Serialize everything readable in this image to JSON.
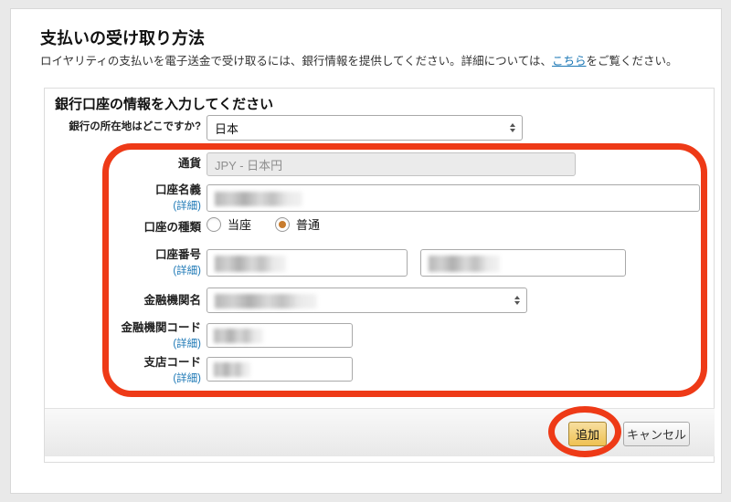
{
  "page": {
    "title": "支払いの受け取り方法",
    "subtitle_before": "ロイヤリティの支払いを電子送金で受け取るには、銀行情報を提供してください。詳細については、",
    "subtitle_link": "こちら",
    "subtitle_after": "をご覧ください。"
  },
  "panel": {
    "title": "銀行口座の情報を入力してください",
    "fields": {
      "bank_location": {
        "label": "銀行の所在地はどこですか?",
        "value": "日本"
      },
      "currency": {
        "label": "通貨",
        "value": "JPY - 日本円",
        "disabled": true
      },
      "account_name": {
        "label": "口座名義",
        "detail_link": "(詳細)",
        "value_redacted": true
      },
      "account_type": {
        "label": "口座の種類",
        "options": [
          {
            "label": "当座",
            "selected": false
          },
          {
            "label": "普通",
            "selected": true
          }
        ]
      },
      "account_number": {
        "label": "口座番号",
        "detail_link": "(詳細)",
        "inputs": 2,
        "values_redacted": true
      },
      "bank_name": {
        "label": "金融機関名",
        "value_redacted": true
      },
      "bank_code": {
        "label": "金融機関コード",
        "detail_link": "(詳細)",
        "value_redacted": true
      },
      "branch_code": {
        "label": "支店コード",
        "detail_link": "(詳細)",
        "value_redacted": true
      }
    }
  },
  "footer": {
    "add_label": "追加",
    "cancel_label": "キャンセル"
  },
  "annotations": {
    "highlight_color": "#ee3a17",
    "fields_highlight": "red-rounded-rectangle",
    "add_button_highlight": "red-ellipse"
  },
  "colors": {
    "annotation_red": "#ee3a17",
    "radio_selected": "#c87c2e",
    "link_blue": "#1b77b5",
    "button_amber": "#efc152"
  }
}
